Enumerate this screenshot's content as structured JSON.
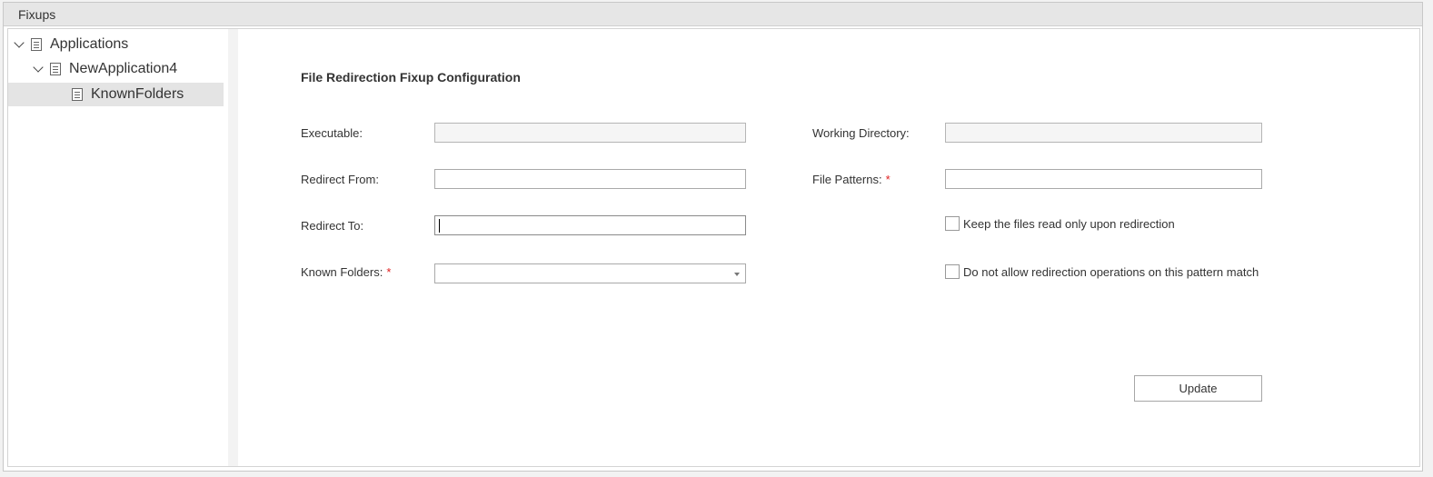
{
  "panel": {
    "title": "Fixups"
  },
  "tree": {
    "root": {
      "label": "Applications",
      "icon": "document-icon"
    },
    "app": {
      "label": "NewApplication4",
      "icon": "document-icon"
    },
    "selected": {
      "label": "KnownFolders",
      "icon": "document-icon"
    }
  },
  "form": {
    "heading": "File Redirection Fixup Configuration",
    "executable_label": "Executable:",
    "executable_value": "",
    "redirect_from_label": "Redirect From:",
    "redirect_from_value": "",
    "redirect_to_label": "Redirect To:",
    "redirect_to_value": "",
    "known_folders_label": "Known Folders:",
    "known_folders_value": "",
    "working_directory_label": "Working Directory:",
    "working_directory_value": "",
    "file_patterns_label": "File Patterns:",
    "file_patterns_value": "",
    "required_marker": "*",
    "keep_read_only_label": "Keep the files read only upon redirection",
    "keep_read_only_checked": false,
    "no_redirect_label": "Do not allow redirection operations on this pattern match",
    "no_redirect_checked": false,
    "update_button": "Update"
  },
  "colors": {
    "header_bg": "#e6e6e6",
    "selected_bg": "#e4e4e4",
    "required": "#e02020"
  }
}
